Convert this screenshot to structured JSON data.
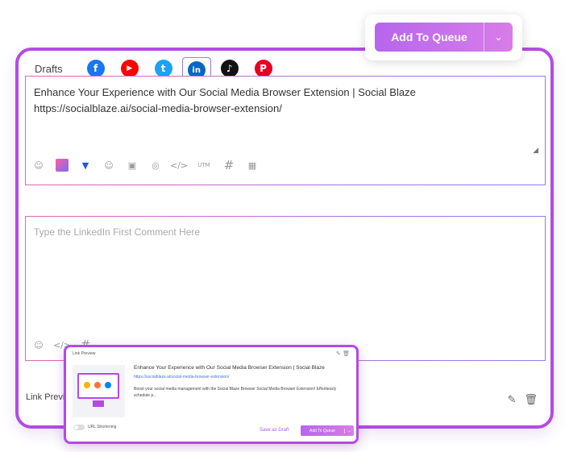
{
  "composer": {
    "drafts_label": "Drafts",
    "networks": [
      {
        "name": "Facebook",
        "icon": "f",
        "color": "#1877f2"
      },
      {
        "name": "YouTube",
        "icon": "▶",
        "color": "#ff0000"
      },
      {
        "name": "Twitter",
        "icon": "t",
        "color": "#1da1f2"
      },
      {
        "name": "LinkedIn",
        "icon": "in",
        "color": "#0a66c2"
      },
      {
        "name": "TikTok",
        "icon": "♪",
        "color": "#111111"
      },
      {
        "name": "Pinterest",
        "icon": "P",
        "color": "#e60023"
      }
    ],
    "post_text": "Enhance Your Experience with Our Social Media Browser Extension | Social Blaze https://socialblaze.ai/social-media-browser-extension/",
    "tools": {
      "utm": "UTM",
      "hashtag": "#",
      "code": "</>"
    },
    "comment_placeholder": "Type the LinkedIn First Comment Here",
    "link_preview_label": "Link Previe"
  },
  "queue_button": {
    "label": "Add To Queue",
    "caret": "⌄"
  },
  "link_preview_card": {
    "header": "Link Preview",
    "title": "Enhance Your Experience with Our Social Media Browser Extension | Social Blaze",
    "url": "https://socialblaze.ai/social-media-browser-extension/",
    "description": "Boost your social media management with the Social Blaze Browser Social Media Browser Extension! Effortlessly schedule p...",
    "url_shortening_label": "URL Shortening",
    "save_draft_label": "Save as Draft",
    "queue_label": "Add To Queue",
    "queue_caret": "⌄"
  }
}
